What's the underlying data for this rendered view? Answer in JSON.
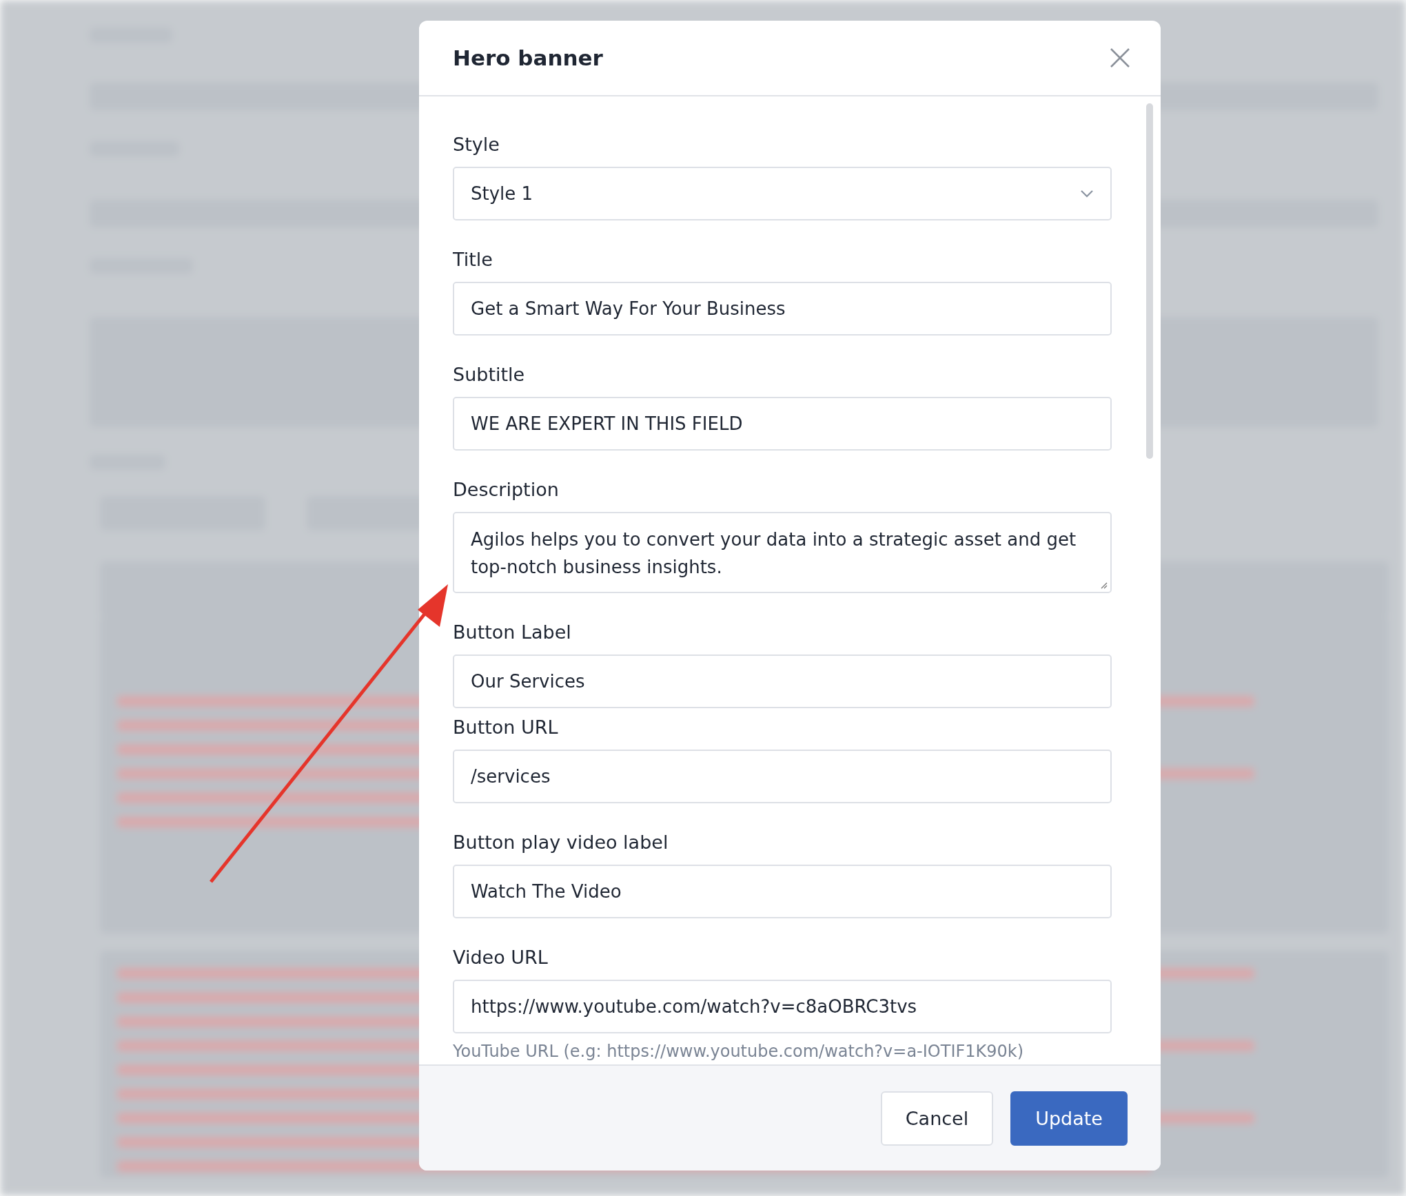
{
  "modal": {
    "title": "Hero banner",
    "fields": [
      {
        "kind": "select",
        "label": "Style",
        "value": "Style 1"
      },
      {
        "kind": "input",
        "label": "Title",
        "value": "Get a Smart Way For Your Business"
      },
      {
        "kind": "input",
        "label": "Subtitle",
        "value": "WE ARE EXPERT IN THIS FIELD"
      },
      {
        "kind": "textarea",
        "label": "Description",
        "value": "Agilos helps you to convert your data into a strategic asset and get top-notch business insights."
      },
      {
        "kind": "input",
        "label": "Button Label",
        "value": "Our Services"
      },
      {
        "kind": "input",
        "label": "Button URL",
        "value": "/services"
      },
      {
        "kind": "input",
        "label": "Button play video label",
        "value": "Watch The Video"
      },
      {
        "kind": "input",
        "label": "Video URL",
        "value": "https://www.youtube.com/watch?v=c8aOBRC3tvs",
        "hint": "YouTube URL (e.g: https://www.youtube.com/watch?v=a-IOTIF1K90k)"
      }
    ],
    "buttons": [
      {
        "kind": "secondary",
        "label": "Cancel"
      },
      {
        "kind": "primary",
        "label": "Update"
      }
    ]
  }
}
